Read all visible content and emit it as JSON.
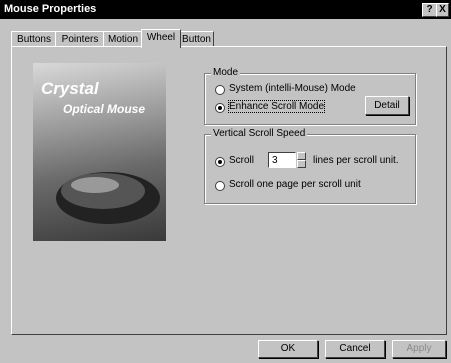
{
  "window": {
    "title": "Mouse Properties",
    "help_btn": "?",
    "close_btn": "X"
  },
  "tabs": [
    {
      "label": "Buttons"
    },
    {
      "label": "Pointers"
    },
    {
      "label": "Motion"
    },
    {
      "label": "Wheel"
    },
    {
      "label": "Button"
    }
  ],
  "box": {
    "line1": "Crystal",
    "line2": "Optical Mouse"
  },
  "mode": {
    "label": "Mode",
    "option1": "System (intelli-Mouse) Mode",
    "option2": "Enhance Scroll Mode",
    "detail_button": "Detail"
  },
  "speed": {
    "label": "Vertical Scroll Speed",
    "scroll_label": "Scroll",
    "scroll_value": "3",
    "lines_label": "lines per scroll unit.",
    "page_label": "Scroll one page per scroll unit"
  },
  "footer": {
    "ok": "OK",
    "cancel": "Cancel",
    "apply": "Apply"
  }
}
